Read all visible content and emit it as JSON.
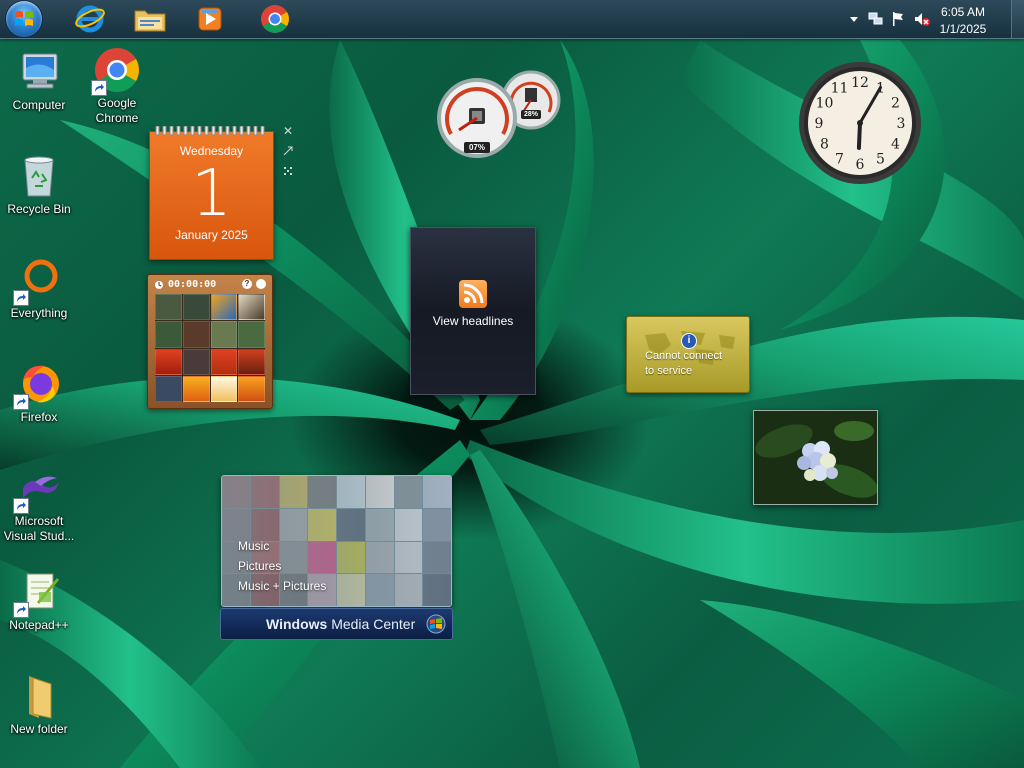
{
  "taskbar": {
    "apps": [
      {
        "name": "Internet Explorer",
        "icon": "ie-icon"
      },
      {
        "name": "Windows Explorer",
        "icon": "folder-icon"
      },
      {
        "name": "Windows Media Player",
        "icon": "media-player-icon"
      },
      {
        "name": "Google Chrome",
        "icon": "chrome-icon"
      }
    ],
    "tray": {
      "time": "6:05 AM",
      "date": "1/1/2025"
    }
  },
  "desktop": {
    "icons": [
      {
        "label": "Computer",
        "icon": "computer-icon"
      },
      {
        "label": "Google Chrome",
        "icon": "chrome-icon"
      },
      {
        "label": "Recycle Bin",
        "icon": "recycle-bin-icon"
      },
      {
        "label": "Everything",
        "icon": "everything-icon"
      },
      {
        "label": "Firefox",
        "icon": "firefox-icon"
      },
      {
        "label": "Microsoft Visual Stud...",
        "icon": "visual-studio-icon"
      },
      {
        "label": "Notepad++",
        "icon": "notepadpp-icon"
      },
      {
        "label": "New folder",
        "icon": "folder-icon"
      }
    ]
  },
  "gadgets": {
    "calendar": {
      "day_name": "Wednesday",
      "day_number": "1",
      "month_year": "January 2025"
    },
    "puzzle": {
      "timer": "00:00:00"
    },
    "cpu_meter": {
      "cpu": "07%",
      "memory": "28%"
    },
    "feeds": {
      "text": "View headlines"
    },
    "currency": {
      "line1": "Cannot connect",
      "line2": "to service"
    },
    "clock": {
      "hour": 6,
      "minute": 5,
      "numerals": [
        "12",
        "1",
        "2",
        "3",
        "4",
        "5",
        "6",
        "7",
        "8",
        "9",
        "10",
        "11"
      ]
    },
    "media_center": {
      "items": [
        "Music",
        "Pictures",
        "Music + Pictures"
      ],
      "title_bold": "Windows",
      "title_rest": " Media Center"
    }
  },
  "colors": {
    "calendar": "#e8661a",
    "currency": "#c8b840",
    "taskbar": "#1f3a4a"
  }
}
